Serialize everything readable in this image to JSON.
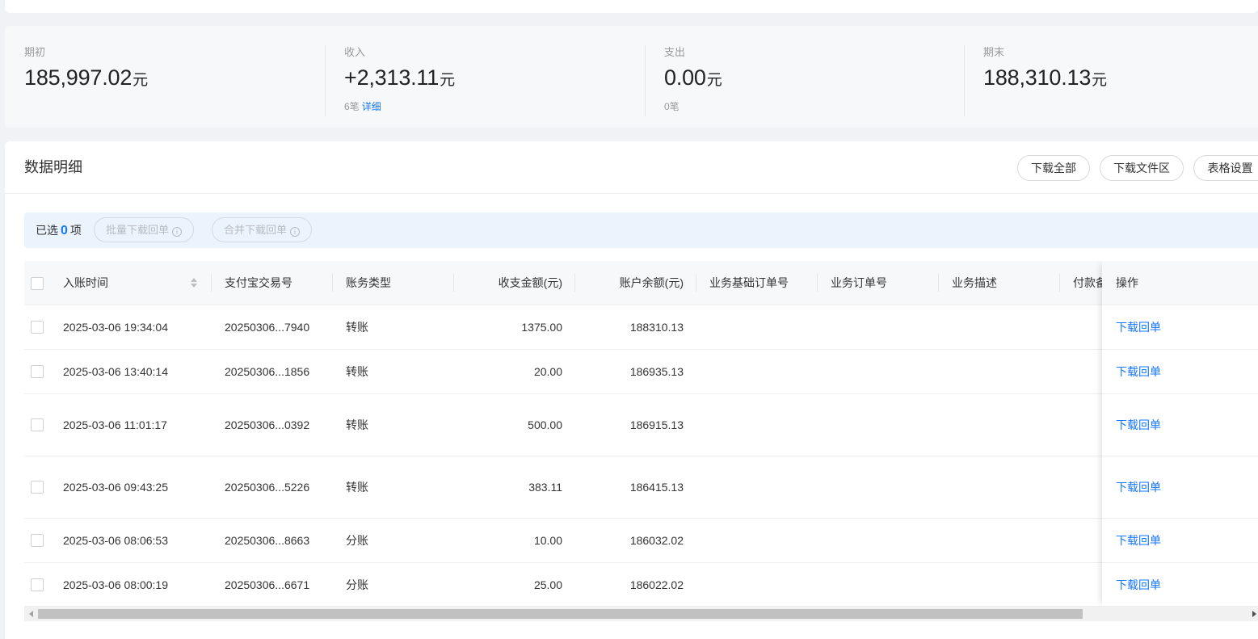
{
  "summary": {
    "opening": {
      "label": "期初",
      "value": "185,997.02",
      "unit": "元"
    },
    "income": {
      "label": "收入",
      "value": "+2,313.11",
      "unit": "元",
      "count": "6笔",
      "detail_link": "详细"
    },
    "expense": {
      "label": "支出",
      "value": "0.00",
      "unit": "元",
      "count": "0笔"
    },
    "closing": {
      "label": "期末",
      "value": "188,310.13",
      "unit": "元"
    }
  },
  "detail": {
    "title": "数据明细",
    "buttons": {
      "download_all": "下载全部",
      "download_files": "下载文件区",
      "table_settings": "表格设置"
    },
    "selection": {
      "prefix": "已选",
      "count": "0",
      "suffix": "项",
      "batch_download": "批量下载回单",
      "merge_download": "合并下载回单",
      "info_glyph": "i"
    }
  },
  "table": {
    "columns": {
      "time": "入账时间",
      "trade_no": "支付宝交易号",
      "type": "账务类型",
      "amount": "收支金额(元)",
      "balance": "账户余额(元)",
      "base_order": "业务基础订单号",
      "order": "业务订单号",
      "desc": "业务描述",
      "payer_note": "付款备",
      "action": "操作"
    },
    "rows": [
      {
        "time": "2025-03-06 19:34:04",
        "trade_no": "20250306...7940",
        "type": "转账",
        "amount": "1375.00",
        "balance": "188310.13",
        "action": "下载回单"
      },
      {
        "time": "2025-03-06 13:40:14",
        "trade_no": "20250306...1856",
        "type": "转账",
        "amount": "20.00",
        "balance": "186935.13",
        "action": "下载回单"
      },
      {
        "time": "2025-03-06 11:01:17",
        "trade_no": "20250306...0392",
        "type": "转账",
        "amount": "500.00",
        "balance": "186915.13",
        "action": "下载回单"
      },
      {
        "time": "2025-03-06 09:43:25",
        "trade_no": "20250306...5226",
        "type": "转账",
        "amount": "383.11",
        "balance": "186415.13",
        "action": "下载回单"
      },
      {
        "time": "2025-03-06 08:06:53",
        "trade_no": "20250306...8663",
        "type": "分账",
        "amount": "10.00",
        "balance": "186032.02",
        "action": "下载回单"
      },
      {
        "time": "2025-03-06 08:00:19",
        "trade_no": "20250306...6671",
        "type": "分账",
        "amount": "25.00",
        "balance": "186022.02",
        "action": "下载回单"
      }
    ]
  },
  "colors": {
    "accent": "#1677ff",
    "selection_bar": "#ebf3fd",
    "summary_bg": "#f7f8fa"
  }
}
